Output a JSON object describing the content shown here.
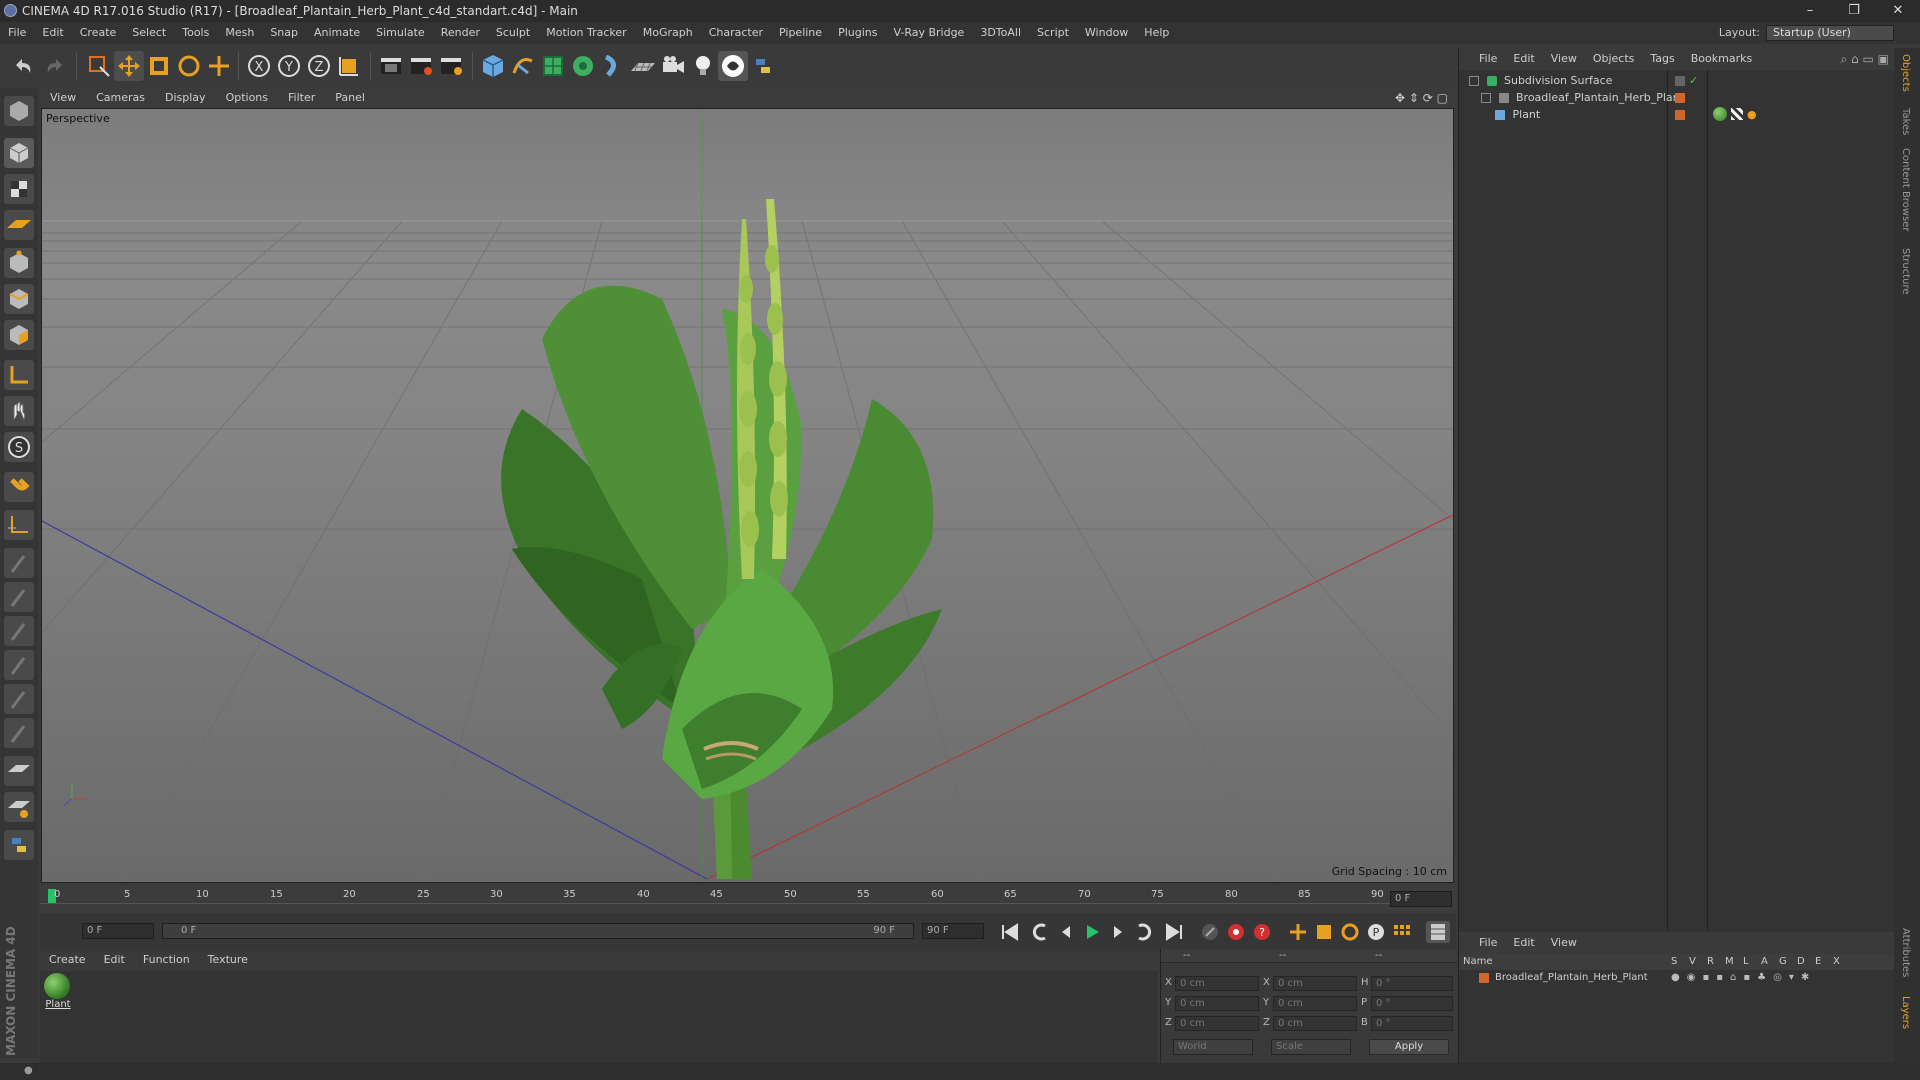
{
  "window": {
    "title": "CINEMA 4D R17.016 Studio (R17) - [Broadleaf_Plantain_Herb_Plant_c4d_standart.c4d] - Main",
    "controls": [
      "–",
      "❐",
      "✕"
    ]
  },
  "menubar": {
    "items": [
      "File",
      "Edit",
      "Create",
      "Select",
      "Tools",
      "Mesh",
      "Snap",
      "Animate",
      "Simulate",
      "Render",
      "Sculpt",
      "Motion Tracker",
      "MoGraph",
      "Character",
      "Pipeline",
      "Plugins",
      "V-Ray Bridge",
      "3DToAll",
      "Script",
      "Window",
      "Help"
    ],
    "layout_label": "Layout:",
    "layout_value": "Startup (User)"
  },
  "toolbar": {
    "icons": [
      "undo-icon",
      "redo-icon",
      "live-selection-icon",
      "move-icon",
      "scale-icon",
      "rotate-icon",
      "recent-tool-icon",
      "x-axis-icon",
      "y-axis-icon",
      "z-axis-icon",
      "coordinate-system-icon",
      "render-view-icon",
      "render-picture-viewer-icon",
      "edit-render-settings-icon",
      "cube-icon",
      "pen-spline-icon",
      "subdivision-icon",
      "array-icon",
      "deformer-icon",
      "floor-icon",
      "camera-icon",
      "light-icon",
      "vray-icon",
      "python-icon"
    ]
  },
  "viewport": {
    "menu": [
      "View",
      "Cameras",
      "Display",
      "Options",
      "Filter",
      "Panel"
    ],
    "label": "Perspective",
    "grid_spacing": "Grid Spacing : 10 cm"
  },
  "timeline": {
    "ticks": [
      "0",
      "5",
      "10",
      "15",
      "20",
      "25",
      "30",
      "35",
      "40",
      "45",
      "50",
      "55",
      "60",
      "65",
      "70",
      "75",
      "80",
      "85",
      "90"
    ],
    "current_frame": "0 F",
    "start_field": "0 F",
    "range_start": "0 F",
    "range_end": "90 F",
    "end_field": "90 F"
  },
  "material_manager": {
    "menu": [
      "Create",
      "Edit",
      "Function",
      "Texture"
    ],
    "materials": [
      {
        "name": "Plant"
      }
    ]
  },
  "coordinates": {
    "headers": [
      "--",
      "--",
      "--"
    ],
    "rows": [
      {
        "a": "X",
        "av": "0 cm",
        "b": "X",
        "bv": "0 cm",
        "c": "H",
        "cv": "0 °"
      },
      {
        "a": "Y",
        "av": "0 cm",
        "b": "Y",
        "bv": "0 cm",
        "c": "P",
        "cv": "0 °"
      },
      {
        "a": "Z",
        "av": "0 cm",
        "b": "Z",
        "bv": "0 cm",
        "c": "B",
        "cv": "0 °"
      }
    ],
    "space": "World",
    "mode": "Scale",
    "apply": "Apply"
  },
  "object_manager": {
    "menu": [
      "File",
      "Edit",
      "View",
      "Objects",
      "Tags",
      "Bookmarks"
    ],
    "objects": [
      {
        "name": "Subdivision Surface",
        "indent": 0
      },
      {
        "name": "Broadleaf_Plantain_Herb_Plant",
        "indent": 1
      },
      {
        "name": "Plant",
        "indent": 2
      }
    ]
  },
  "layer_manager": {
    "menu": [
      "File",
      "Edit",
      "View"
    ],
    "header_name": "Name",
    "header_flags": [
      "S",
      "V",
      "R",
      "M",
      "L",
      "A",
      "G",
      "D",
      "E",
      "X"
    ],
    "layers": [
      {
        "name": "Broadleaf_Plantain_Herb_Plant",
        "color": "#d0662a"
      }
    ]
  },
  "side_tabs": [
    "Objects",
    "Takes",
    "Content Browser",
    "Structure",
    "Attributes",
    "Layers"
  ],
  "branding": "MAXON CINEMA 4D",
  "colors": {
    "accent": "#d0662a",
    "active_blue": "#5a8fd0",
    "keyframe_green": "#26c26a"
  }
}
